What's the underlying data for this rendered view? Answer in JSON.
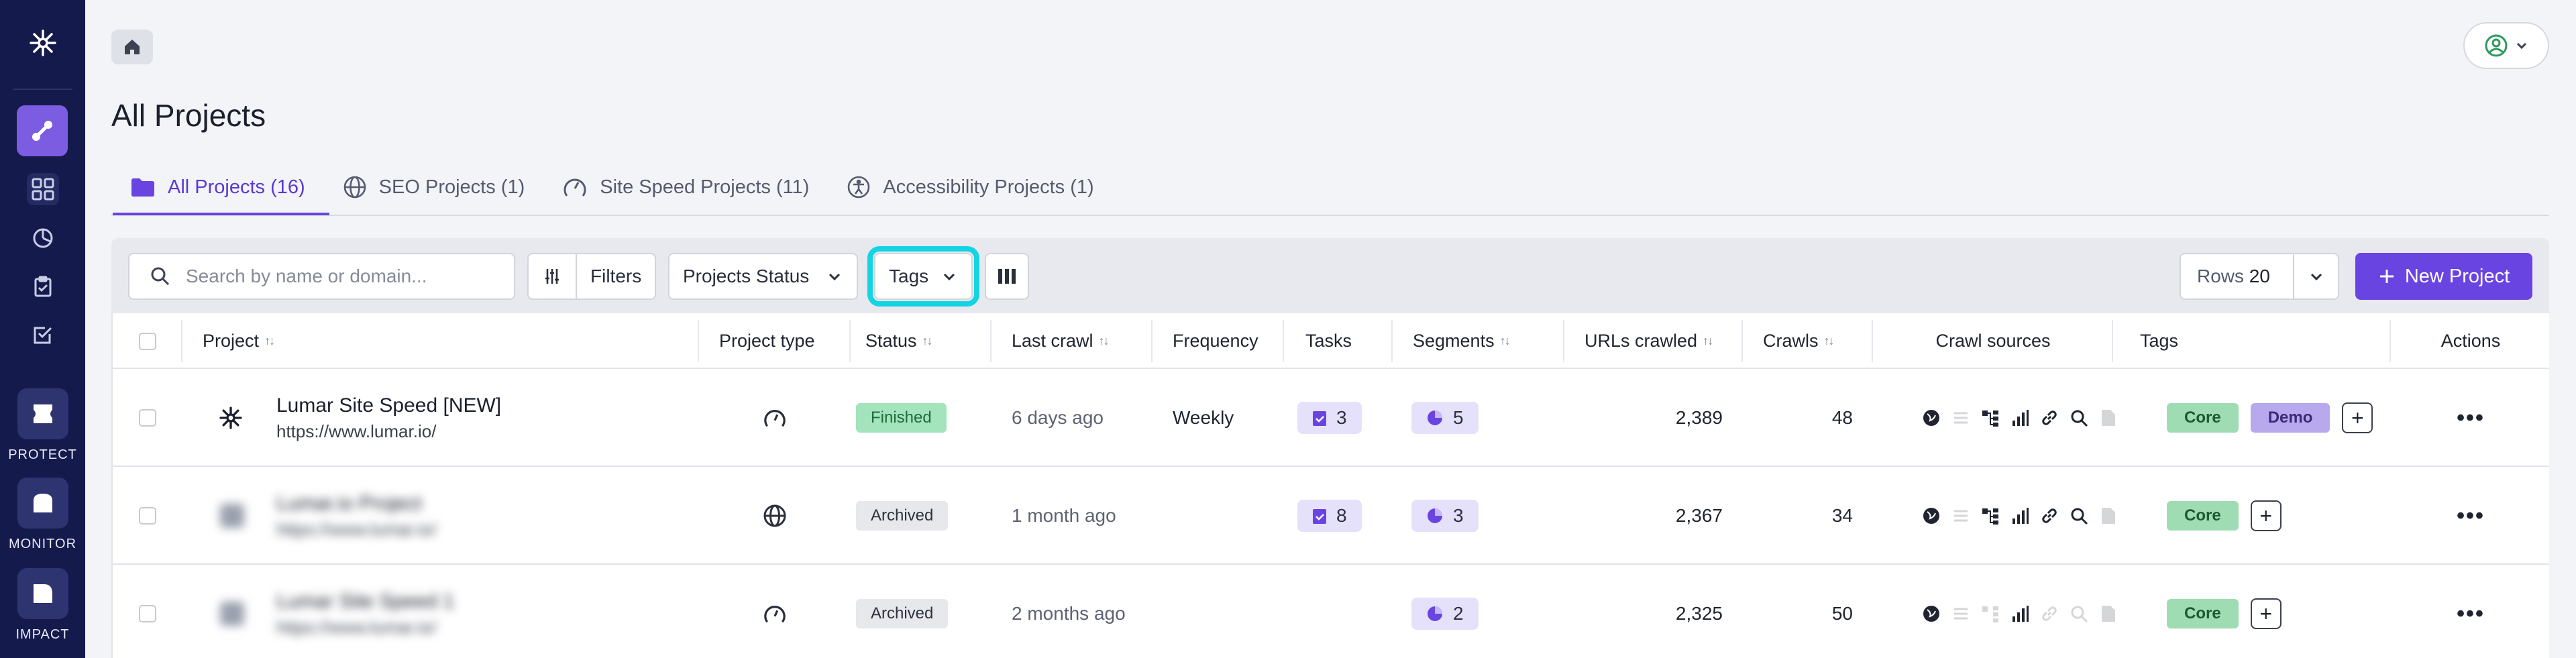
{
  "page": {
    "title": "All Projects"
  },
  "sidebar": {
    "products": [
      {
        "label": "PROTECT"
      },
      {
        "label": "MONITOR"
      },
      {
        "label": "IMPACT"
      }
    ]
  },
  "tabs": [
    {
      "label": "All Projects (16)",
      "active": true
    },
    {
      "label": "SEO Projects (1)"
    },
    {
      "label": "Site Speed Projects (11)"
    },
    {
      "label": "Accessibility Projects (1)"
    }
  ],
  "toolbar": {
    "search_placeholder": "Search by name or domain...",
    "filters_label": "Filters",
    "status_label": "Projects Status",
    "tags_label": "Tags",
    "rows_label": "Rows",
    "rows_value": "20",
    "new_project_label": "New Project"
  },
  "columns": [
    "Project",
    "Project type",
    "Status",
    "Last crawl",
    "Frequency",
    "Tasks",
    "Segments",
    "URLs crawled",
    "Crawls",
    "Crawl sources",
    "Tags",
    "Actions"
  ],
  "rows": [
    {
      "name": "Lumar Site Speed [NEW]",
      "url": "https://www.lumar.io/",
      "type": "speed-icon",
      "status": "Finished",
      "last_crawl": "6 days ago",
      "frequency": "Weekly",
      "tasks": "3",
      "segments": "5",
      "urls": "2,389",
      "crawls": "48",
      "tags": [
        "Core",
        "Demo"
      ]
    },
    {
      "name": "Lumar.io Project",
      "url": "https://www.lumar.io/",
      "type": "globe-icon",
      "status": "Archived",
      "last_crawl": "1 month ago",
      "frequency": "",
      "tasks": "8",
      "segments": "3",
      "urls": "2,367",
      "crawls": "34",
      "tags": [
        "Core"
      ]
    },
    {
      "name": "Lumar Site Speed 1",
      "url": "https://www.lumar.io/",
      "type": "speed-icon",
      "status": "Archived",
      "last_crawl": "2 months ago",
      "frequency": "",
      "tasks": "",
      "segments": "2",
      "urls": "2,325",
      "crawls": "50",
      "tags": [
        "Core"
      ]
    }
  ],
  "colors": {
    "accent": "#6a44e0",
    "sidebar": "#141a4c",
    "highlight": "#14d4e4"
  }
}
